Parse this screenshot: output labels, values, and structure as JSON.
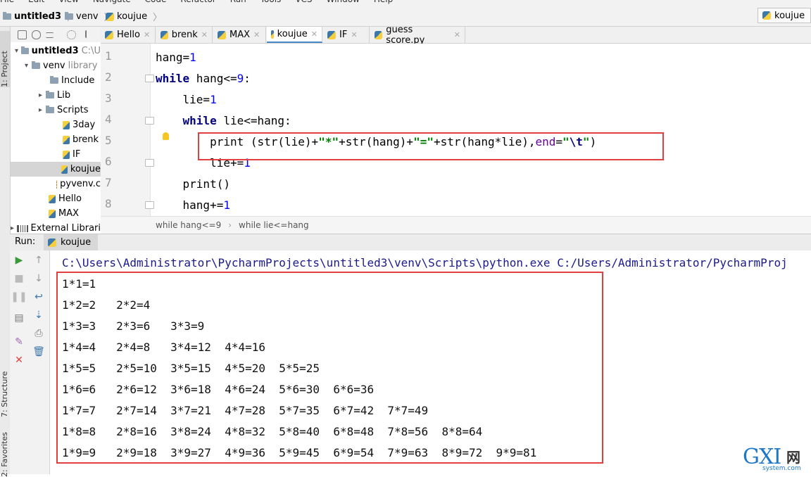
{
  "menu": [
    "File",
    "Edit",
    "View",
    "Navigate",
    "Code",
    "Refactor",
    "Run",
    "Tools",
    "VCS",
    "Window",
    "Help"
  ],
  "nav": {
    "project": "untitled3",
    "folder": "venv",
    "file": "koujue"
  },
  "run_config": "koujue",
  "side_labels": {
    "project": "1: Project",
    "structure": "7: Structure",
    "favorites": "2: Favorites"
  },
  "tree": [
    {
      "label": "untitled3",
      "extra": "C:\\U",
      "arrow": "▾",
      "type": "folder",
      "indent": 6,
      "bold": true
    },
    {
      "label": "venv",
      "extra": "library",
      "arrow": "▾",
      "type": "folder",
      "indent": 20
    },
    {
      "label": "Include",
      "arrow": "",
      "type": "folder",
      "indent": 46
    },
    {
      "label": "Lib",
      "arrow": "▸",
      "type": "folder",
      "indent": 40
    },
    {
      "label": "Scripts",
      "arrow": "▸",
      "type": "folder",
      "indent": 40
    },
    {
      "label": "3day",
      "arrow": "",
      "type": "file",
      "indent": 64
    },
    {
      "label": "brenk",
      "arrow": "",
      "type": "file",
      "indent": 64
    },
    {
      "label": "IF",
      "arrow": "",
      "type": "file",
      "indent": 64
    },
    {
      "label": "koujue",
      "arrow": "",
      "type": "file",
      "indent": 64,
      "selected": true
    },
    {
      "label": "pyvenv.c",
      "arrow": "",
      "type": "cfg",
      "indent": 64
    },
    {
      "label": "Hello",
      "arrow": "",
      "type": "file",
      "indent": 44
    },
    {
      "label": "MAX",
      "arrow": "",
      "type": "file",
      "indent": 44
    },
    {
      "label": "External Librari",
      "arrow": "▸",
      "type": "lib",
      "indent": 0
    }
  ],
  "tabs": [
    "Hello",
    "brenk",
    "MAX",
    "koujue",
    "IF",
    "guess score.py"
  ],
  "active_tab": "koujue",
  "line_numbers": [
    "1",
    "2",
    "3",
    "4",
    "5",
    "6",
    "7",
    "8"
  ],
  "editor_breadcrumb": [
    "while hang<=9",
    "while lie<=hang"
  ],
  "run": {
    "label": "Run:",
    "tab": "koujue"
  },
  "console": {
    "command": "C:\\Users\\Administrator\\PycharmProjects\\untitled3\\venv\\Scripts\\python.exe C:/Users/Administrator/PycharmProj",
    "lines": [
      "1*1=1",
      "1*2=2   2*2=4",
      "1*3=3   2*3=6   3*3=9",
      "1*4=4   2*4=8   3*4=12  4*4=16",
      "1*5=5   2*5=10  3*5=15  4*5=20  5*5=25",
      "1*6=6   2*6=12  3*6=18  4*6=24  5*6=30  6*6=36",
      "1*7=7   2*7=14  3*7=21  4*7=28  5*7=35  6*7=42  7*7=49",
      "1*8=8   2*8=16  3*8=24  4*8=32  5*8=40  6*8=48  7*8=56  8*8=64",
      "1*9=9   2*9=18  3*9=27  4*9=36  5*9=45  6*9=54  7*9=63  8*9=72  9*9=81"
    ]
  },
  "watermark": {
    "logo": "GXI",
    "cn": "网",
    "url": "system.com"
  },
  "colors": {
    "highlight_box": "#e04040",
    "keyword": "#000080",
    "string": "#008000",
    "number": "#0000ff"
  }
}
